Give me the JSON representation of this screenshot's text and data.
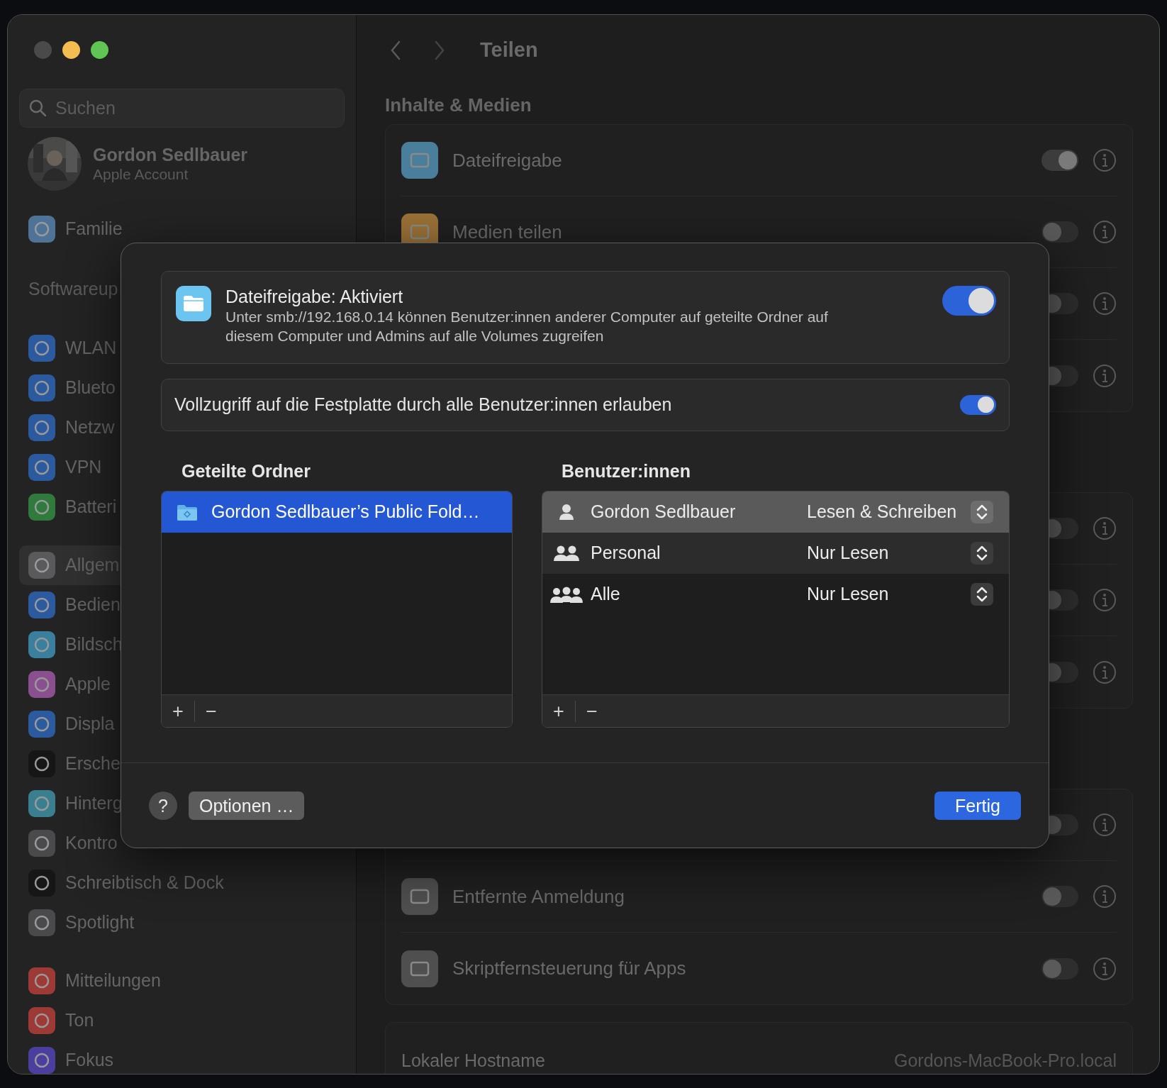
{
  "window": {
    "traffic_lights": [
      {
        "kind": "close",
        "disabled": true
      },
      {
        "kind": "minimize",
        "disabled": false
      },
      {
        "kind": "zoom",
        "disabled": false
      }
    ]
  },
  "sidebar": {
    "search": {
      "placeholder": "Suchen"
    },
    "account": {
      "name": "Gordon Sedlbauer",
      "subtitle": "Apple Account"
    },
    "groups": [
      [
        {
          "kind": "item",
          "label": "Familie",
          "color": "#4f7396",
          "selected": false
        }
      ],
      [
        {
          "kind": "text",
          "label": "Softwareup"
        }
      ],
      [
        {
          "kind": "item",
          "label": "WLAN",
          "color": "#2c5a9e",
          "selected": false
        },
        {
          "kind": "item",
          "label": "Blueto",
          "color": "#2c5a9e",
          "selected": false
        },
        {
          "kind": "item",
          "label": "Netzw",
          "color": "#2c5a9e",
          "selected": false
        },
        {
          "kind": "item",
          "label": "VPN",
          "color": "#2c5a9e",
          "selected": false
        },
        {
          "kind": "item",
          "label": "Batteri",
          "color": "#2f7a3c",
          "selected": false
        }
      ],
      [
        {
          "kind": "item",
          "label": "Allgem",
          "color": "#5a5a5c",
          "selected": true
        },
        {
          "kind": "item",
          "label": "Bedien",
          "color": "#2c5a9e",
          "selected": false
        },
        {
          "kind": "item",
          "label": "Bildsch",
          "color": "#3a7f9e",
          "selected": false
        },
        {
          "kind": "item",
          "label": "Apple",
          "color": "#8a4f8f",
          "selected": false
        },
        {
          "kind": "item",
          "label": "Displa",
          "color": "#2c5a9e",
          "selected": false
        },
        {
          "kind": "item",
          "label": "Ersche",
          "color": "#161616",
          "selected": false
        },
        {
          "kind": "item",
          "label": "Hinterg",
          "color": "#3a7f8f",
          "selected": false
        },
        {
          "kind": "item",
          "label": "Kontro",
          "color": "#4a4a4c",
          "selected": false
        },
        {
          "kind": "item",
          "label": "Schreibtisch & Dock",
          "color": "#161616",
          "selected": false
        },
        {
          "kind": "item",
          "label": "Spotlight",
          "color": "#4a4a4c",
          "selected": false
        }
      ],
      [
        {
          "kind": "item",
          "label": "Mitteilungen",
          "color": "#9e3a36",
          "selected": false
        },
        {
          "kind": "item",
          "label": "Ton",
          "color": "#9e3a36",
          "selected": false
        },
        {
          "kind": "item",
          "label": "Fokus",
          "color": "#4a3f9e",
          "selected": false
        }
      ]
    ]
  },
  "main": {
    "title": "Teilen",
    "section": "Inhalte & Medien",
    "cards": [
      [
        {
          "label": "Dateifreigabe",
          "color": "#4a7f9b",
          "on": true
        },
        {
          "label": "Medien teilen",
          "color": "#9b7236",
          "on": false
        },
        {
          "on": false
        },
        {
          "on": false
        }
      ],
      [
        {
          "on": false
        },
        {
          "on": false
        },
        {
          "on": false
        }
      ],
      [
        {
          "on": false
        },
        {
          "label": "Entfernte Anmeldung",
          "color": "#4f4f4f",
          "on": false
        },
        {
          "label": "Skriptfernsteuerung für Apps",
          "color": "#4f4f4f",
          "on": false
        }
      ]
    ],
    "hostname": {
      "label": "Lokaler Hostname",
      "value": "Gordons-MacBook-Pro.local"
    }
  },
  "sheet": {
    "service": {
      "title": "Dateifreigabe: Aktiviert",
      "description": "Unter smb://192.168.0.14 können Benutzer:innen anderer Computer auf geteilte Ordner auf diesem Computer und Admins auf alle Volumes zugreifen",
      "on": true
    },
    "full_access": {
      "label": "Vollzugriff auf die Festplatte durch alle Benutzer:innen erlauben",
      "on": true
    },
    "folders": {
      "heading": "Geteilte Ordner",
      "items": [
        {
          "label": "Gordon Sedlbauer’s Public Fold…",
          "selected": true
        }
      ],
      "add": "+",
      "remove": "−"
    },
    "users": {
      "heading": "Benutzer:innen",
      "items": [
        {
          "kind": "user",
          "name": "Gordon Sedlbauer",
          "permission": "Lesen & Schreiben",
          "selected": true
        },
        {
          "kind": "group",
          "name": "Personal",
          "permission": "Nur Lesen",
          "selected": false
        },
        {
          "kind": "everyone",
          "name": "Alle",
          "permission": "Nur Lesen",
          "selected": false
        }
      ],
      "add": "+",
      "remove": "−"
    },
    "help": "?",
    "options": "Optionen …",
    "done": "Fertig"
  }
}
